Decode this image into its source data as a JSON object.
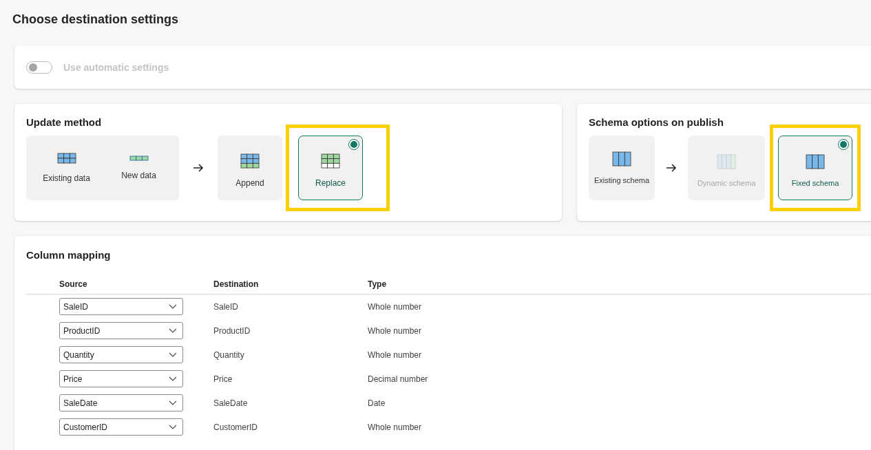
{
  "title": "Choose destination settings",
  "auto_settings": {
    "label": "Use automatic settings",
    "on": false,
    "disabled": true
  },
  "update_method": {
    "title": "Update method",
    "sources": [
      {
        "label": "Existing data",
        "kind": "blue-grid"
      },
      {
        "label": "New data",
        "kind": "green-strip"
      }
    ],
    "options": [
      {
        "label": "Append",
        "kind": "append-grid",
        "selected": false,
        "disabled": false,
        "highlighted": false
      },
      {
        "label": "Replace",
        "kind": "replace-grid",
        "selected": true,
        "disabled": false,
        "highlighted": true
      }
    ]
  },
  "schema_options": {
    "title": "Schema options on publish",
    "sources": [
      {
        "label": "Existing schema",
        "kind": "columns"
      }
    ],
    "options": [
      {
        "label": "Dynamic schema",
        "kind": "dynamic-columns",
        "selected": false,
        "disabled": true,
        "highlighted": false
      },
      {
        "label": "Fixed schema",
        "kind": "columns",
        "selected": true,
        "disabled": false,
        "highlighted": true
      }
    ]
  },
  "column_mapping": {
    "title": "Column mapping",
    "columns": [
      "Source",
      "Destination",
      "Type"
    ],
    "rows": [
      {
        "source": "SaleID",
        "destination": "SaleID",
        "type": "Whole number"
      },
      {
        "source": "ProductID",
        "destination": "ProductID",
        "type": "Whole number"
      },
      {
        "source": "Quantity",
        "destination": "Quantity",
        "type": "Whole number"
      },
      {
        "source": "Price",
        "destination": "Price",
        "type": "Decimal number"
      },
      {
        "source": "SaleDate",
        "destination": "SaleDate",
        "type": "Date"
      },
      {
        "source": "CustomerID",
        "destination": "CustomerID",
        "type": "Whole number"
      }
    ]
  }
}
